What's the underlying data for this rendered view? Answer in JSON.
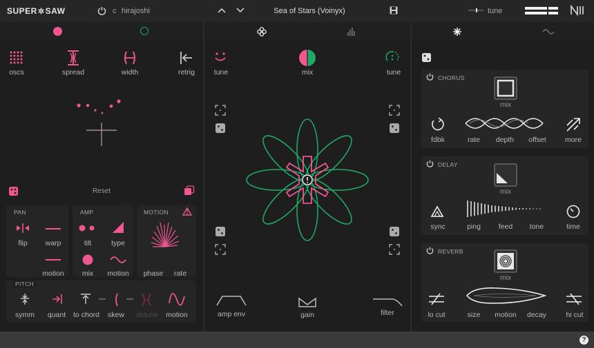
{
  "header": {
    "logo_left": "SUPER",
    "logo_right": "SAW",
    "preset_category": "c",
    "scale_name": "hirajoshi",
    "preset_name": "Sea of Stars (Voinyx)",
    "tune_label": "tune"
  },
  "left": {
    "top_labels": [
      "oscs",
      "spread",
      "width",
      "retrig"
    ],
    "reset_label": "Reset",
    "pan": {
      "title": "PAN",
      "flip": "flip",
      "warp": "warp",
      "motion": "motion"
    },
    "amp": {
      "title": "AMP",
      "tilt": "tilt",
      "type": "type",
      "mix": "mix",
      "motion": "motion"
    },
    "motion": {
      "title": "MOTION",
      "phase": "phase",
      "rate": "rate"
    },
    "pitch": {
      "title": "PITCH",
      "symm": "symm",
      "quant": "quant",
      "to_chord": "to chord",
      "skew": "skew",
      "detune": "detune",
      "motion": "motion"
    }
  },
  "center": {
    "tune_left": "tune",
    "mix": "mix",
    "tune_right": "tune",
    "amp_env": "amp env",
    "gain": "gain",
    "filter": "filter"
  },
  "right": {
    "chorus": {
      "title": "CHORUS",
      "mix": "mix",
      "fdbk": "fdbk",
      "rate": "rate",
      "depth": "depth",
      "offset": "offset",
      "more": "more"
    },
    "delay": {
      "title": "DELAY",
      "mix": "mix",
      "sync": "sync",
      "ping": "ping",
      "feed": "feed",
      "tone": "tone",
      "time": "time"
    },
    "reverb": {
      "title": "REVERB",
      "mix": "mix",
      "lo_cut": "lo cut",
      "size": "size",
      "motion": "motion",
      "decay": "decay",
      "hi_cut": "hi cut"
    }
  },
  "footer": {
    "help": "?"
  },
  "colors": {
    "pink": "#f0568f",
    "green": "#1fa866",
    "bg": "#1b1b1c"
  }
}
